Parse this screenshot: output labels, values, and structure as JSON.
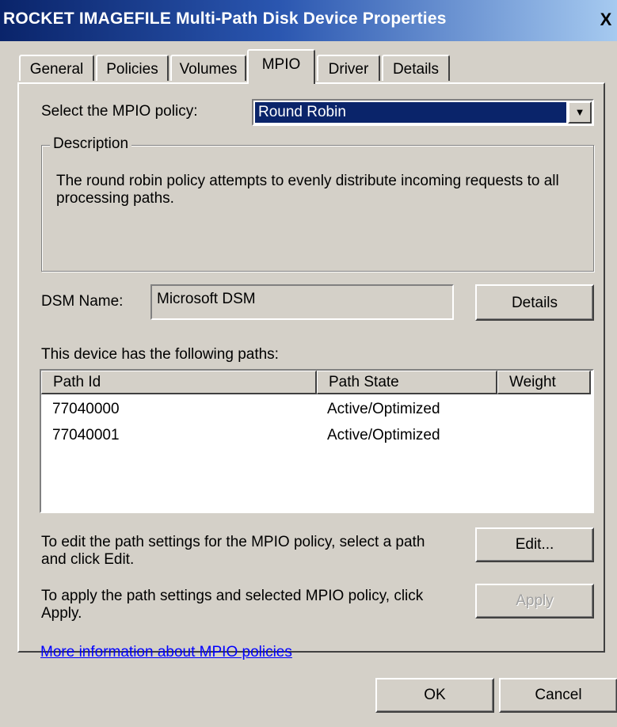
{
  "window": {
    "title": "ROCKET IMAGEFILE  Multi-Path Disk Device Properties",
    "close_glyph": "X"
  },
  "tabs": [
    {
      "label": "General"
    },
    {
      "label": "Policies"
    },
    {
      "label": "Volumes"
    },
    {
      "label": "MPIO",
      "active": true
    },
    {
      "label": "Driver"
    },
    {
      "label": "Details"
    }
  ],
  "mpio": {
    "policy_label": "Select the MPIO policy:",
    "policy_value": "Round Robin",
    "description_legend": "Description",
    "description_text": "The round robin policy attempts to evenly distribute incoming requests to all processing paths.",
    "dsm_label": "DSM Name:",
    "dsm_value": "Microsoft DSM",
    "details_button": "Details",
    "paths_label": "This device has the following paths:",
    "paths_columns": [
      "Path Id",
      "Path State",
      "Weight"
    ],
    "paths_rows": [
      {
        "id": "77040000",
        "state": "Active/Optimized",
        "weight": ""
      },
      {
        "id": "77040001",
        "state": "Active/Optimized",
        "weight": ""
      }
    ],
    "edit_text": "To edit the path settings for the MPIO policy, select a path and click Edit.",
    "edit_button": "Edit...",
    "apply_text": "To apply the path settings and selected MPIO policy, click Apply.",
    "apply_button": "Apply",
    "more_info_link": "More information about MPIO policies"
  },
  "footer": {
    "ok_button": "OK",
    "cancel_button": "Cancel"
  },
  "colors": {
    "title_bar_start": "#0a246a",
    "title_bar_end": "#a6caf0",
    "selection": "#0a246a",
    "dialog_bg": "#d4d0c8",
    "link": "#0000ff"
  }
}
